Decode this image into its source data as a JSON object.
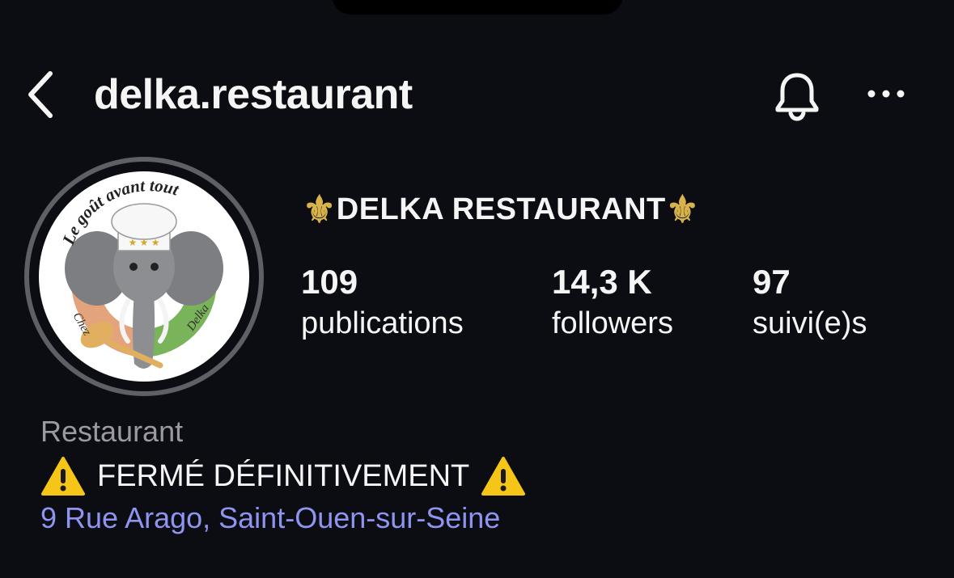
{
  "header": {
    "username": "delka.restaurant",
    "back_icon": "chevron-left-icon",
    "bell_icon": "bell-icon",
    "more_icon": "more-horizontal-icon"
  },
  "profile": {
    "display_name": "DELKA RESTAURANT",
    "decoration_icon": "fleur-de-lis-icon",
    "avatar_logo": {
      "slogan": "Le goût avant tout",
      "left_text": "Chez",
      "right_text": "Delka"
    },
    "stats": [
      {
        "value": "109",
        "label": "publications"
      },
      {
        "value": "14,3 K",
        "label": "followers"
      },
      {
        "value": "97",
        "label": "suivi(e)s"
      }
    ],
    "category": "Restaurant",
    "bio": "FERMÉ DÉFINITIVEMENT",
    "bio_icon": "warning-icon",
    "address": "9 Rue Arago, Saint-Ouen-sur-Seine"
  },
  "colors": {
    "background": "#0c0d12",
    "text": "#f5f5f5",
    "muted": "#9a9aa0",
    "link": "#8f94f0",
    "fleur": "#d8b24a",
    "warning": "#f5c518"
  }
}
